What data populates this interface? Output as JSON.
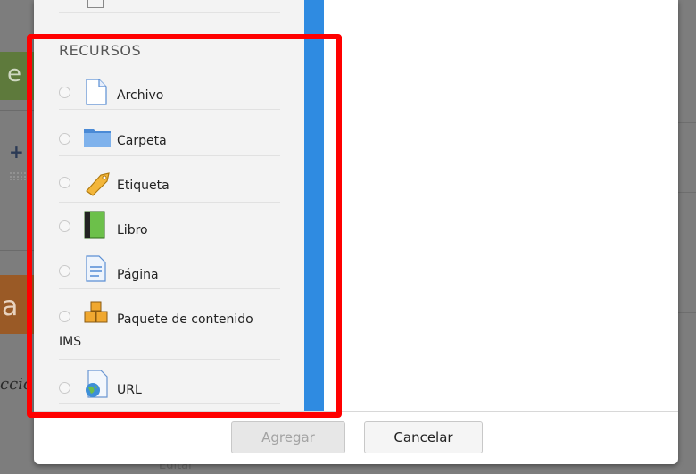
{
  "background": {
    "left_letter_top": "e",
    "left_letter_mid": "a",
    "left_italic": "ccio",
    "bottom_text": "Editar"
  },
  "chooser": {
    "section_title": "RECURSOS",
    "items": [
      {
        "label": "Archivo",
        "icon": "file-icon"
      },
      {
        "label": "Carpeta",
        "icon": "folder-icon"
      },
      {
        "label": "Etiqueta",
        "icon": "tag-icon"
      },
      {
        "label": "Libro",
        "icon": "book-icon"
      },
      {
        "label": "Página",
        "icon": "page-icon"
      },
      {
        "label": "Paquete de contenido",
        "label_cont": "IMS",
        "icon": "ims-package-icon"
      },
      {
        "label": "URL",
        "icon": "url-globe-icon"
      }
    ]
  },
  "footer": {
    "add_label": "Agregar",
    "cancel_label": "Cancelar"
  },
  "colors": {
    "scrollbar": "#2f8be1",
    "highlight": "#ff0000",
    "overlay": "#7d7d7d"
  }
}
